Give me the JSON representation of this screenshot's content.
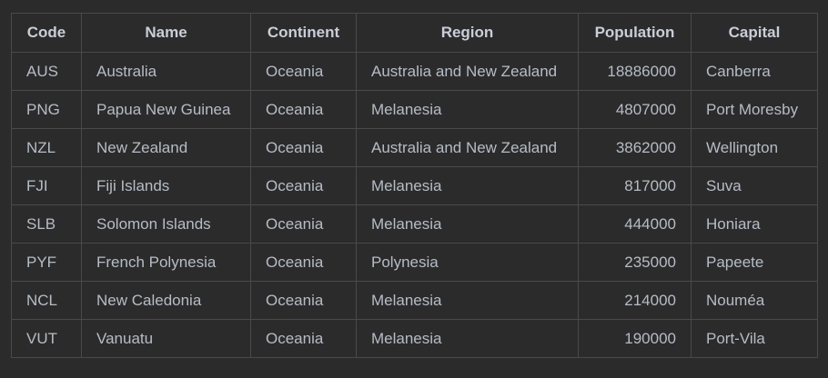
{
  "table": {
    "headers": [
      "Code",
      "Name",
      "Continent",
      "Region",
      "Population",
      "Capital"
    ],
    "rows": [
      [
        "AUS",
        "Australia",
        "Oceania",
        "Australia and New Zealand",
        "18886000",
        "Canberra"
      ],
      [
        "PNG",
        "Papua New Guinea",
        "Oceania",
        "Melanesia",
        "4807000",
        "Port Moresby"
      ],
      [
        "NZL",
        "New Zealand",
        "Oceania",
        "Australia and New Zealand",
        "3862000",
        "Wellington"
      ],
      [
        "FJI",
        "Fiji Islands",
        "Oceania",
        "Melanesia",
        "817000",
        "Suva"
      ],
      [
        "SLB",
        "Solomon Islands",
        "Oceania",
        "Melanesia",
        "444000",
        "Honiara"
      ],
      [
        "PYF",
        "French Polynesia",
        "Oceania",
        "Polynesia",
        "235000",
        "Papeete"
      ],
      [
        "NCL",
        "New Caledonia",
        "Oceania",
        "Melanesia",
        "214000",
        "Nouméa"
      ],
      [
        "VUT",
        "Vanuatu",
        "Oceania",
        "Melanesia",
        "190000",
        "Port-Vila"
      ]
    ]
  },
  "colors": {
    "background": "#2b2b2b",
    "border": "#4a4a4a",
    "header_text": "#c9ced8",
    "cell_text": "#b6bcc6"
  }
}
